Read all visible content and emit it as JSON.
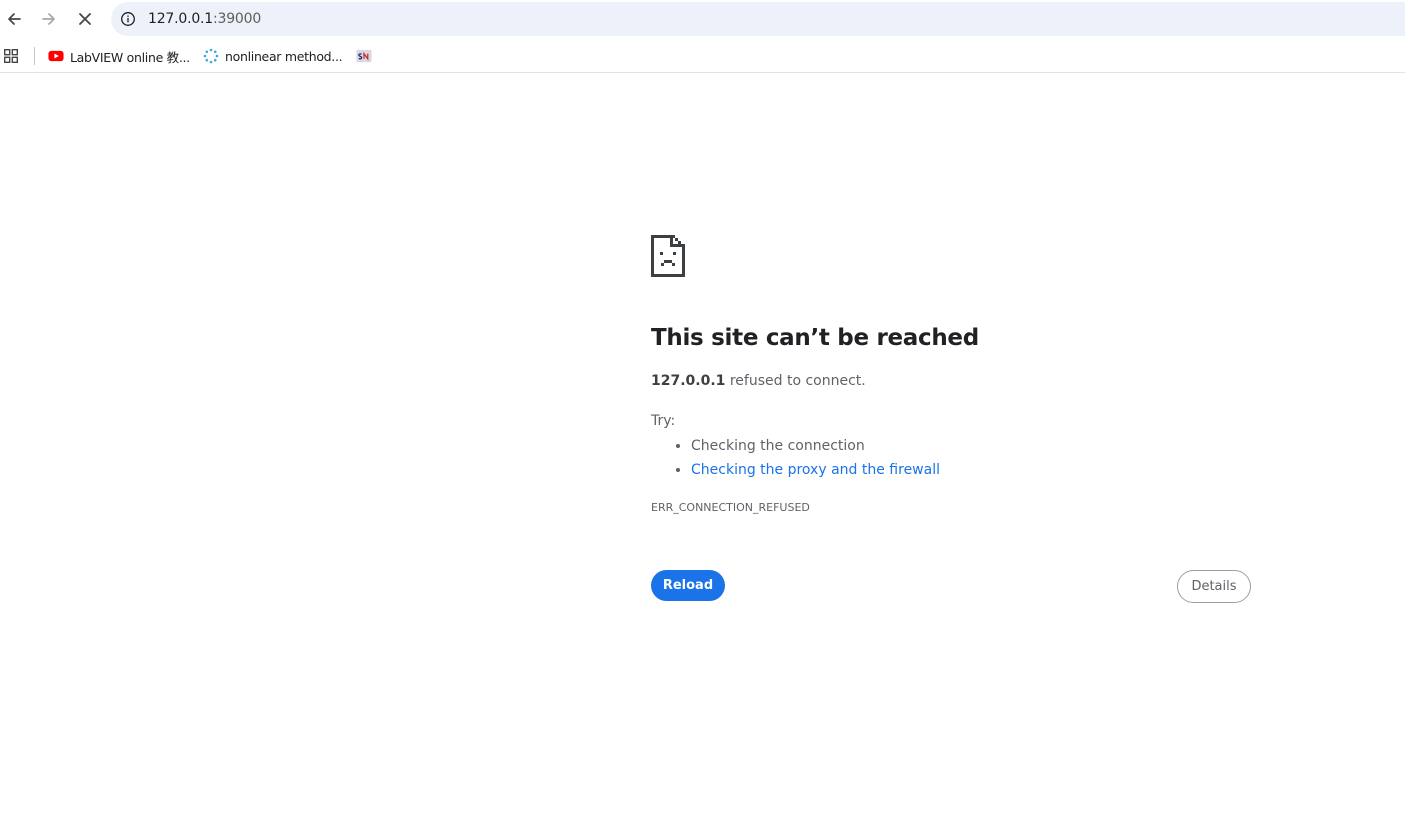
{
  "browser": {
    "url_host": "127.0.0.1",
    "url_port": ":39000"
  },
  "bookmarks": [
    {
      "label": "LabVIEW online 教...",
      "icon": "youtube-icon"
    },
    {
      "label": "nonlinear method...",
      "icon": "loading-spinner-icon"
    },
    {
      "label": "",
      "icon": "sn-logo-icon"
    }
  ],
  "error_page": {
    "title": "This site can’t be reached",
    "host": "127.0.0.1",
    "summary_rest": " refused to connect.",
    "try_label": "Try:",
    "suggestions": [
      "Checking the connection",
      "Checking the proxy and the firewall"
    ],
    "error_code": "ERR_CONNECTION_REFUSED",
    "reload_label": "Reload",
    "details_label": "Details"
  },
  "colors": {
    "accent": "#1a73e8",
    "omnibox_bg": "#edf2fa",
    "text_primary": "#202124",
    "text_secondary": "#5f6368"
  }
}
